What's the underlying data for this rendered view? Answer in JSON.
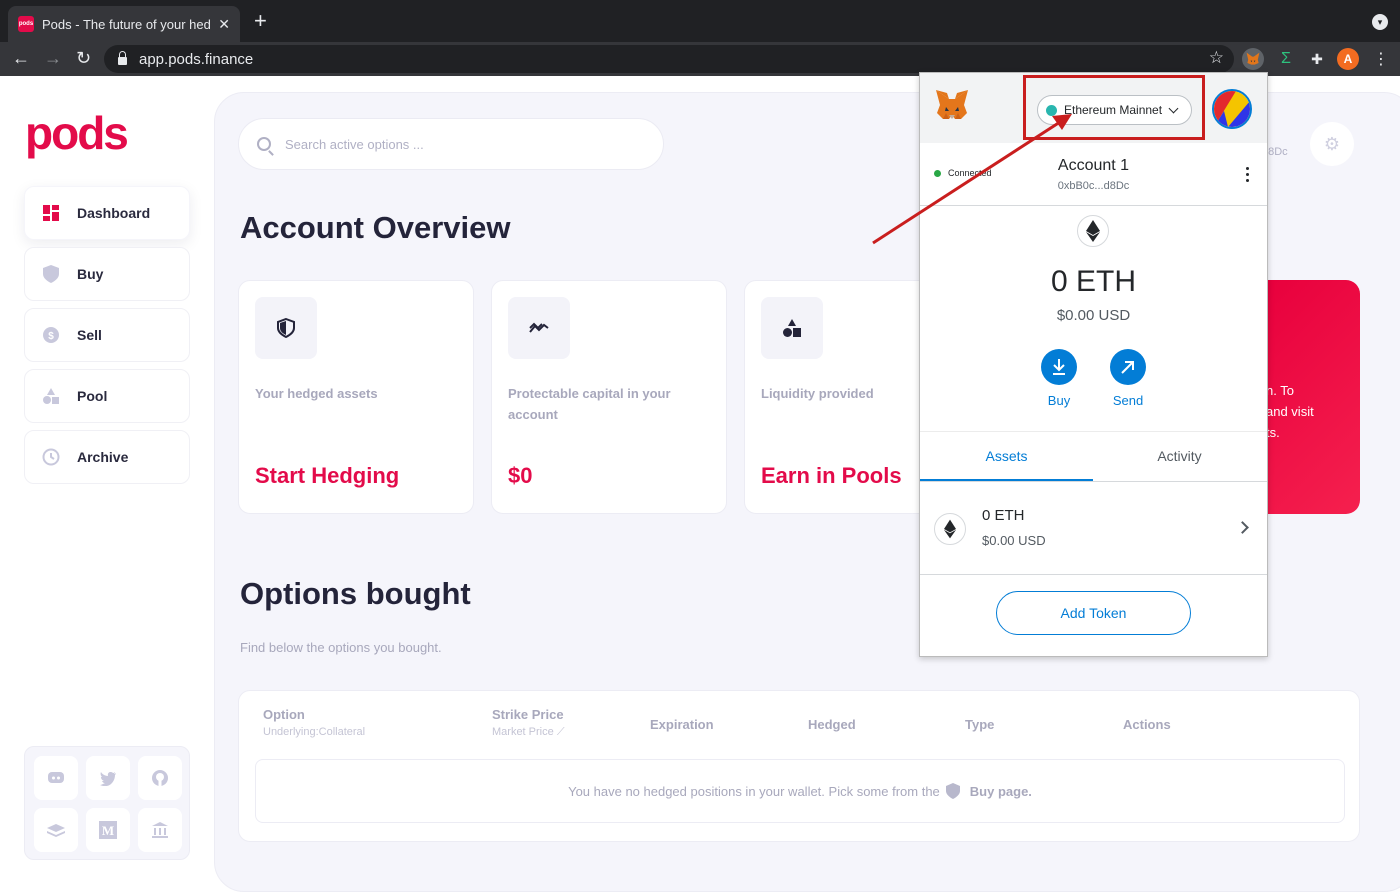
{
  "browser": {
    "tab_title": "Pods - The future of your hedg",
    "tab_favicon_text": "pods",
    "url": "app.pods.finance",
    "profile_initial": "A"
  },
  "app": {
    "logo": "pods",
    "nav": [
      {
        "label": "Dashboard",
        "icon": "dashboard-icon"
      },
      {
        "label": "Buy",
        "icon": "shield-icon"
      },
      {
        "label": "Sell",
        "icon": "coin-icon"
      },
      {
        "label": "Pool",
        "icon": "shapes-icon"
      },
      {
        "label": "Archive",
        "icon": "history-icon"
      }
    ],
    "social_icons": [
      "discord-icon",
      "twitter-icon",
      "github-icon",
      "docs-icon",
      "medium-icon",
      "bank-icon"
    ],
    "search_placeholder": "Search active options ...",
    "address_partial": "d8Dc",
    "page_title": "Account Overview",
    "cards": [
      {
        "label": "Your hedged assets",
        "value": "Start Hedging",
        "icon": "shield-icon"
      },
      {
        "label": "Protectable capital in your account",
        "value": "$0",
        "icon": "trend-icon"
      },
      {
        "label": "Liquidity provided",
        "value": "Earn in Pools",
        "icon": "shapes-icon"
      }
    ],
    "promo_partial": [
      "n. To",
      "and visit",
      "ts."
    ],
    "options_title": "Options bought",
    "options_subtitle": "Find below the options you bought.",
    "table": {
      "columns": [
        {
          "label": "Option",
          "sub": "Underlying:Collateral"
        },
        {
          "label": "Strike Price",
          "sub": "Market Price"
        },
        {
          "label": "Expiration",
          "sub": ""
        },
        {
          "label": "Hedged",
          "sub": ""
        },
        {
          "label": "Type",
          "sub": ""
        },
        {
          "label": "Actions",
          "sub": ""
        }
      ],
      "empty_text": "You have no hedged positions in your wallet. Pick some from the",
      "empty_link": "Buy page."
    }
  },
  "metamask": {
    "network": "Ethereum Mainnet",
    "connection_status": "Connected",
    "account_name": "Account 1",
    "account_address": "0xbB0c...d8Dc",
    "balance": "0 ETH",
    "balance_usd": "$0.00 USD",
    "actions": [
      "Buy",
      "Send"
    ],
    "tabs": [
      "Assets",
      "Activity"
    ],
    "asset": {
      "balance": "0 ETH",
      "usd": "$0.00 USD"
    },
    "add_token": "Add Token",
    "colors": {
      "primary": "#037dd6",
      "network_dot": "#29b6af",
      "highlight": "#c91e1e"
    }
  }
}
